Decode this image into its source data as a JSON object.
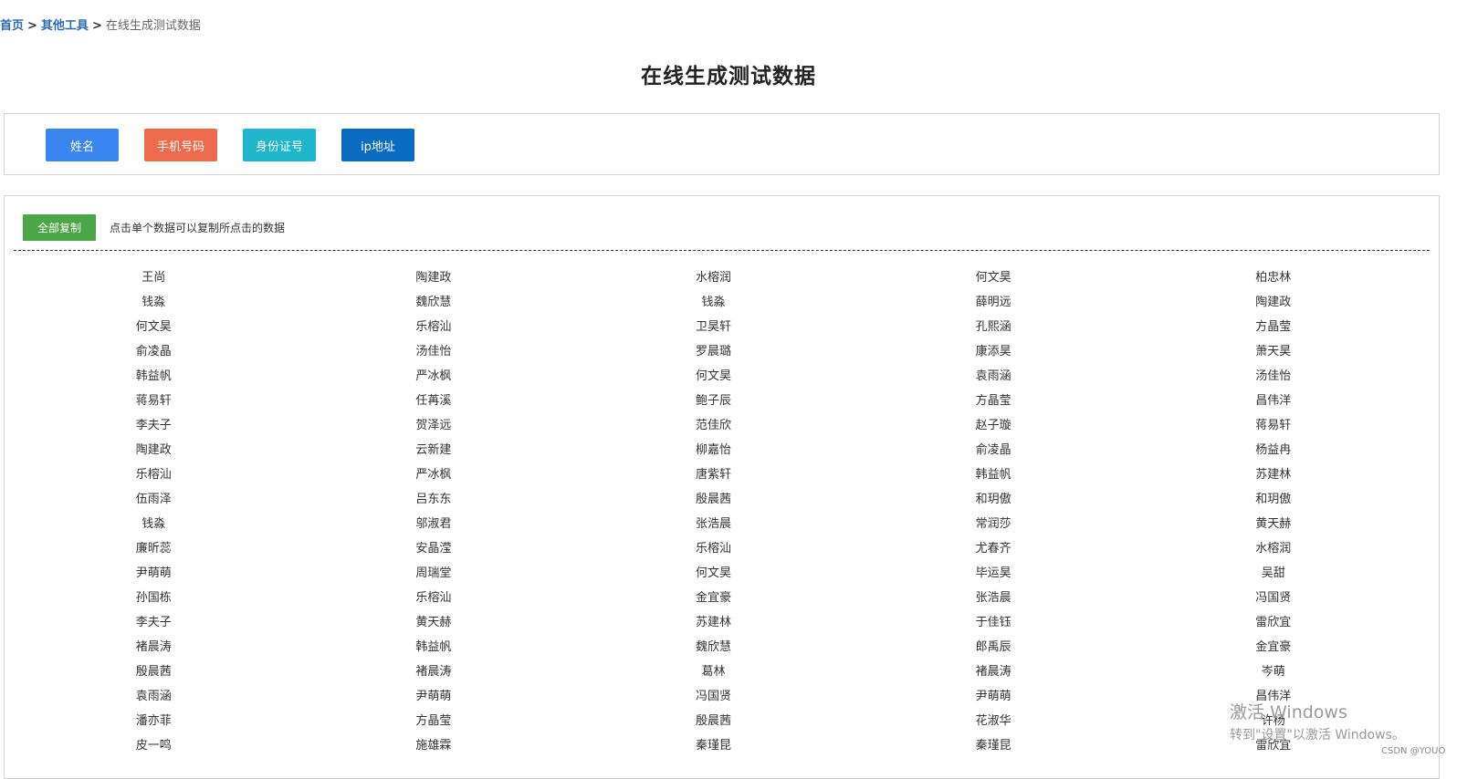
{
  "breadcrumb": {
    "home": "首页",
    "sep1": ">",
    "tools": "其他工具",
    "sep2": ">",
    "current": "在线生成测试数据"
  },
  "title": "在线生成测试数据",
  "tool_buttons": [
    {
      "label": "姓名",
      "color": "#3a86f0"
    },
    {
      "label": "手机号码",
      "color": "#ee6a4c"
    },
    {
      "label": "身份证号",
      "color": "#1fb6cc"
    },
    {
      "label": "ip地址",
      "color": "#0a6cc0"
    }
  ],
  "copy_all_label": "全部复制",
  "hint": "点击单个数据可以复制所点击的数据",
  "names": [
    [
      "王尚",
      "陶建政",
      "水榕润",
      "何文昊",
      "柏忠林"
    ],
    [
      "钱淼",
      "魏欣慧",
      "钱淼",
      "薛明远",
      "陶建政"
    ],
    [
      "何文昊",
      "乐榕汕",
      "卫昊轩",
      "孔熙涵",
      "方晶莹"
    ],
    [
      "俞凌晶",
      "汤佳怡",
      "罗晨璐",
      "康添昊",
      "萧天昊"
    ],
    [
      "韩益帆",
      "严冰枫",
      "何文昊",
      "袁雨涵",
      "汤佳怡"
    ],
    [
      "蒋易轩",
      "任苒溪",
      "鲍子辰",
      "方晶莹",
      "昌伟洋"
    ],
    [
      "李夫子",
      "贺泽远",
      "范佳欣",
      "赵子璇",
      "蒋易轩"
    ],
    [
      "陶建政",
      "云新建",
      "柳嘉怡",
      "俞凌晶",
      "杨益冉"
    ],
    [
      "乐榕汕",
      "严冰枫",
      "唐紫轩",
      "韩益帆",
      "苏建林"
    ],
    [
      "伍雨泽",
      "吕东东",
      "殷晨茜",
      "和玥傲",
      "和玥傲"
    ],
    [
      "钱淼",
      "邬淑君",
      "张浩晨",
      "常润莎",
      "黄天赫"
    ],
    [
      "廉昕蕊",
      "安晶滢",
      "乐榕汕",
      "尤春齐",
      "水榕润"
    ],
    [
      "尹萌萌",
      "周瑞堂",
      "何文昊",
      "毕运昊",
      "吴甜"
    ],
    [
      "孙国栋",
      "乐榕汕",
      "金宜豪",
      "张浩晨",
      "冯国贤"
    ],
    [
      "李夫子",
      "黄天赫",
      "苏建林",
      "于佳钰",
      "雷欣宜"
    ],
    [
      "褚晨涛",
      "韩益帆",
      "魏欣慧",
      "郎禹辰",
      "金宜豪"
    ],
    [
      "殷晨茜",
      "褚晨涛",
      "葛林",
      "褚晨涛",
      "岑萌"
    ],
    [
      "袁雨涵",
      "尹萌萌",
      "冯国贤",
      "尹萌萌",
      "昌伟洋"
    ],
    [
      "潘亦菲",
      "方晶莹",
      "殷晨茜",
      "花淑华",
      "许杨"
    ],
    [
      "皮一鸣",
      "施雄霖",
      "秦瑾昆",
      "秦瑾昆",
      "雷欣宜"
    ]
  ],
  "watermark": {
    "line1": "激活 Windows",
    "line2": "转到\"设置\"以激活 Windows。"
  },
  "csdn": "CSDN @YOUO"
}
